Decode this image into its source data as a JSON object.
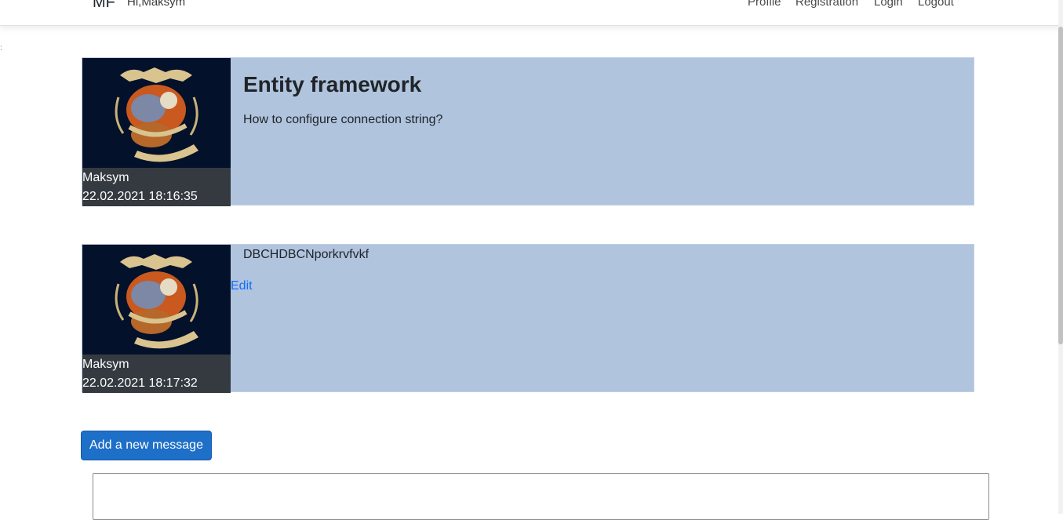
{
  "nav": {
    "brand": "MF",
    "greeting": "Hi,Maksym",
    "links": [
      "Profile",
      "Registration",
      "Login",
      "Logout"
    ]
  },
  "messages": [
    {
      "author": "Maksym",
      "timestamp": "22.02.2021 18:16:35",
      "title": "Entity framework",
      "body": "How to configure connection string?",
      "avatar_icon": "skull-crest-emblem-icon"
    },
    {
      "author": "Maksym",
      "timestamp": "22.02.2021 18:17:32",
      "body": "DBCHDBCNporkrvfvkf",
      "edit_label": "Edit",
      "avatar_icon": "skull-crest-emblem-icon"
    }
  ],
  "compose": {
    "add_button": "Add a new message",
    "textarea_value": ""
  },
  "colors": {
    "card_background": "#b0c4de",
    "sidebar_dark": "#343a40",
    "primary_button": "#1e6fc8",
    "link": "#0d6efd"
  }
}
